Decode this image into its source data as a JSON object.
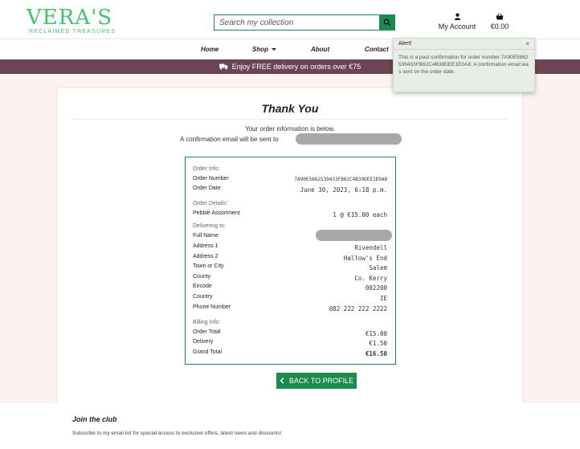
{
  "brand": {
    "name": "VERA'S",
    "tagline": "RECLAIMED TREASURES"
  },
  "search": {
    "placeholder": "Search my collection"
  },
  "account": {
    "label": "My Account"
  },
  "cart": {
    "total": "€0.00"
  },
  "nav": {
    "home": "Home",
    "shop": "Shop",
    "about": "About",
    "contact": "Contact"
  },
  "banner": {
    "text": "Enjoy FREE delivery on orders over €75"
  },
  "page": {
    "title": "Thank You",
    "intro_line1": "Your order information is below.",
    "intro_line2": "A confirmation email will be sent to"
  },
  "order": {
    "info_label": "Order Info:",
    "number_label": "Order Number",
    "number": "7A90E5862539433FB62C4B39DEE1E0A8",
    "date_label": "Order Date",
    "date": "June 30, 2023, 6:18 p.m.",
    "details_label": "Order Details:",
    "item_name": "Pebble Assortment",
    "item_qty": "1 @ €15.00 each",
    "delivering_label": "Delivering to:",
    "full_name_label": "Full Name",
    "address1_label": "Address 1",
    "address1": "Rivendell",
    "address2_label": "Address 2",
    "address2": "Hallow's End",
    "town_label": "Town or City",
    "town": "Salem",
    "county_label": "County",
    "county": "Co. Kerry",
    "eircode_label": "Eircode",
    "eircode": "002200",
    "country_label": "Country",
    "country": "IE",
    "phone_label": "Phone Number",
    "phone": "082 222 222 2222",
    "billing_label": "Billing Info:",
    "order_total_label": "Order Total",
    "order_total": "€15.00",
    "delivery_label": "Delivery",
    "delivery": "€1.50",
    "grand_total_label": "Grand Total",
    "grand_total": "€16.50"
  },
  "back_button": {
    "label": "BACK TO PROFILE"
  },
  "footer": {
    "title": "Join the club",
    "text": "Subscribe to my email list for special access to exclusive offers, latest news and discounts!"
  },
  "alert": {
    "title": "Alert!",
    "close": "×",
    "message": "This is a past confirmation for order number 7A90E5862539433FB62C4B39DEE1E0A8. A confirmation email was sent on the order date."
  },
  "colors": {
    "brand_green": "#3fc46b",
    "primary_green": "#1c8a4c",
    "banner_plum": "#6d4454",
    "page_bg": "#fdf2f0"
  }
}
